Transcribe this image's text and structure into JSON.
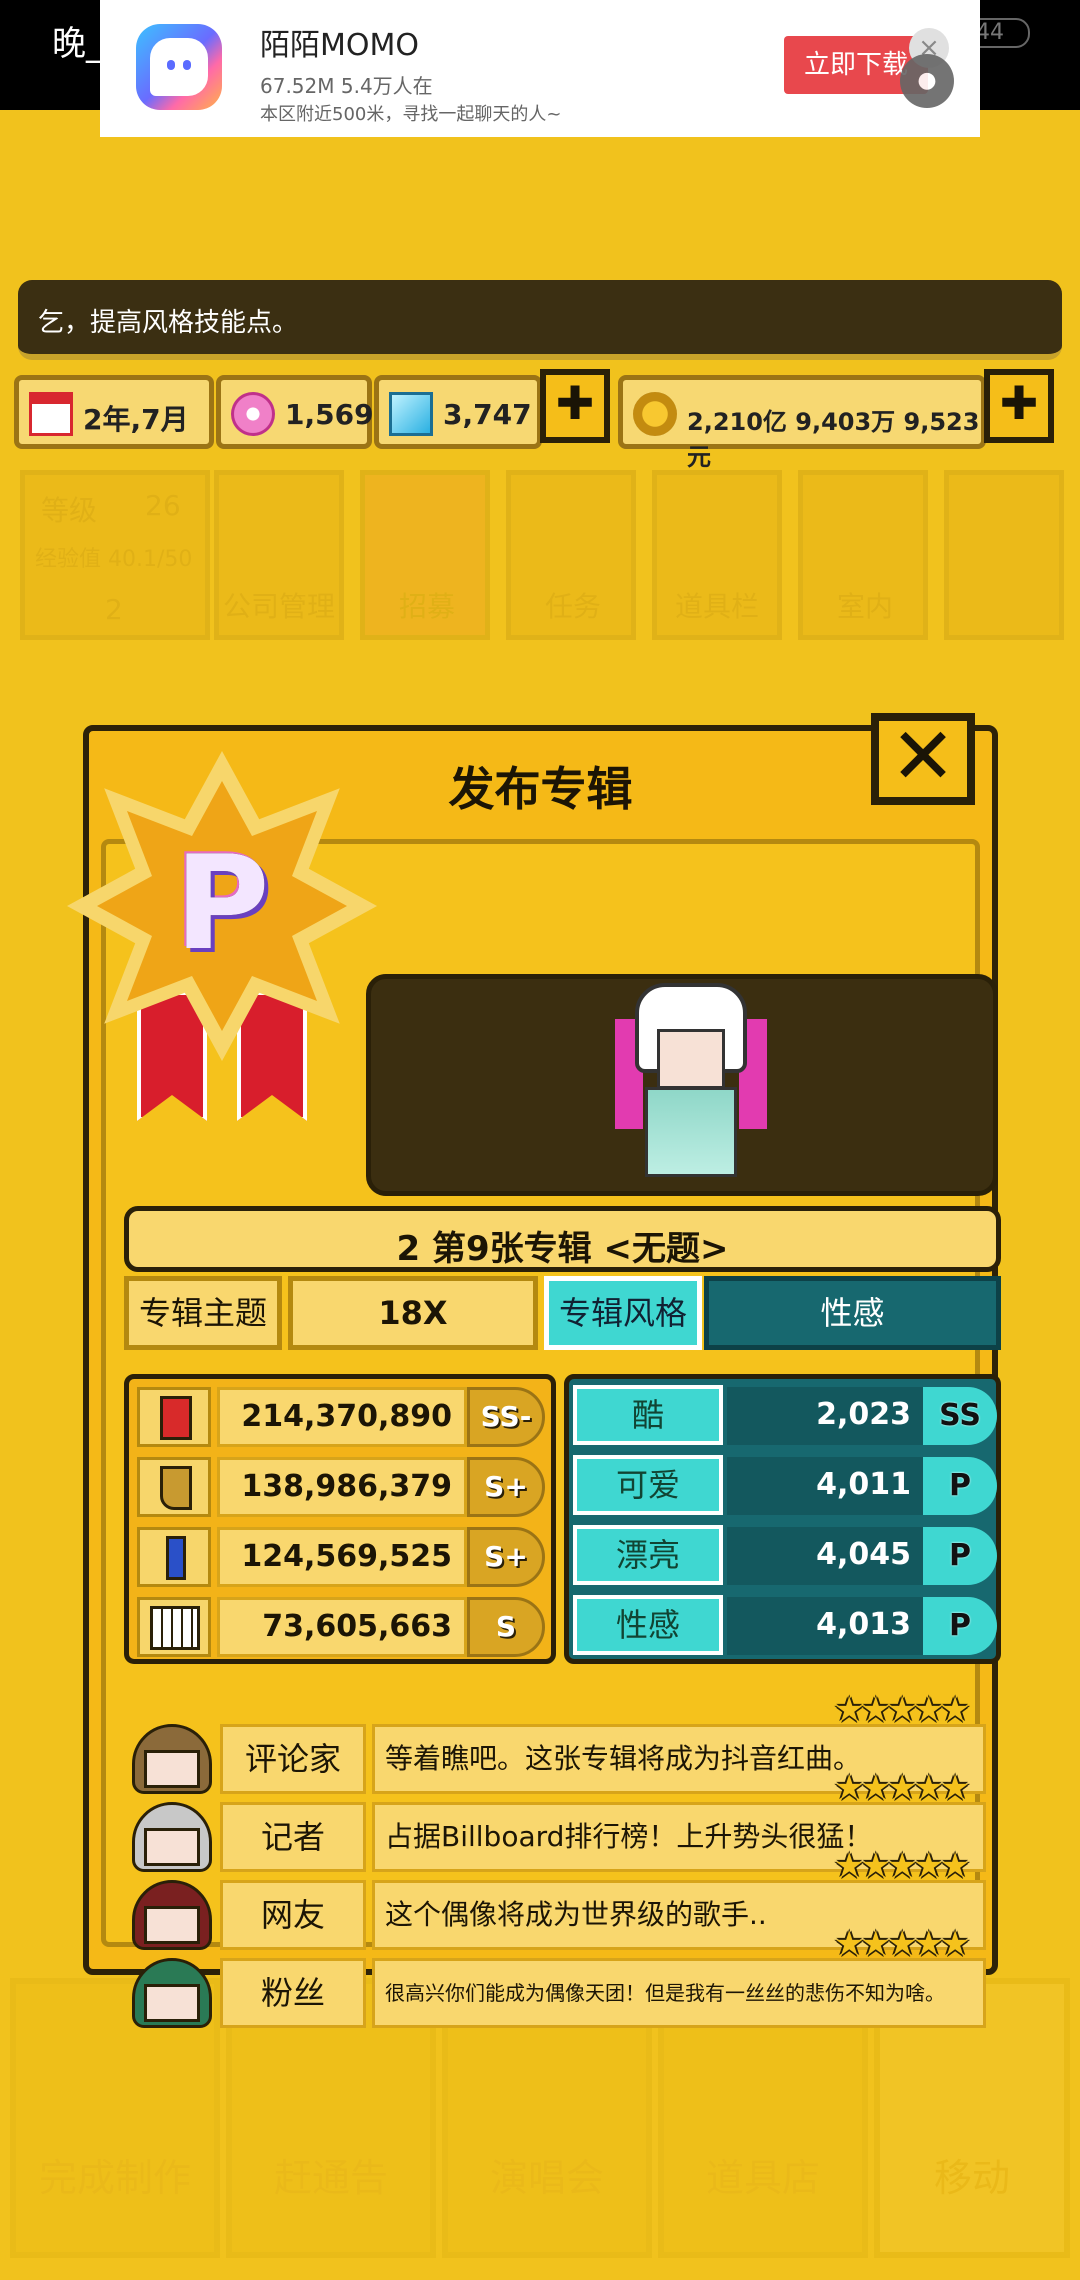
{
  "status": {
    "time": "晚_",
    "battery": "44"
  },
  "ad": {
    "title": "陌陌MOMO",
    "subtitle1": "67.52M 5.4万人在",
    "subtitle2": "本区附近500米，寻找一起聊天的人~",
    "cta": "立即下载",
    "close": "×"
  },
  "tip": "乞，提高风格技能点。",
  "resources": {
    "date": "2年,7月",
    "gems": "1,569",
    "diamonds": "3,747",
    "money": "2,210亿 9,403万 9,523元",
    "plus": "✚"
  },
  "background": {
    "level_label": "等级",
    "level": "26",
    "exp_label": "经验值 40.1/50",
    "level_num": "2",
    "tabs": [
      "公司管理",
      "招募",
      "任务",
      "道具栏",
      "室内"
    ],
    "bottom_nav": [
      "完成制作",
      "赶通告",
      "演唱会",
      "道具店",
      "移动"
    ]
  },
  "dialog": {
    "title": "发布专辑",
    "close": "✕",
    "medal_letter": "P",
    "album_title": "2 第9张专辑 <无题>",
    "theme_label": "专辑主题",
    "theme_value": "18X",
    "style_label": "专辑风格",
    "style_value": "性感",
    "stats_left": [
      {
        "icon": "mic-icon",
        "value": "214,370,890",
        "grade": "SS-"
      },
      {
        "icon": "boot-icon",
        "value": "138,986,379",
        "grade": "S+"
      },
      {
        "icon": "pen-icon",
        "value": "124,569,525",
        "grade": "S+"
      },
      {
        "icon": "piano-icon",
        "value": "73,605,663",
        "grade": "S"
      }
    ],
    "stats_right": [
      {
        "label": "酷",
        "value": "2,023",
        "grade": "SS"
      },
      {
        "label": "可爱",
        "value": "4,011",
        "grade": "P"
      },
      {
        "label": "漂亮",
        "value": "4,045",
        "grade": "P"
      },
      {
        "label": "性感",
        "value": "4,013",
        "grade": "P"
      }
    ],
    "reviews": [
      {
        "role": "评论家",
        "text": "等着瞧吧。这张专辑将成为抖音红曲。",
        "stars": 5,
        "hair": "#8b6a3a"
      },
      {
        "role": "记者",
        "text": "占据Billboard排行榜！上升势头很猛！",
        "stars": 5,
        "hair": "#c8c8c8"
      },
      {
        "role": "网友",
        "text": "这个偶像将成为世界级的歌手..",
        "stars": 5,
        "hair": "#7a2020"
      },
      {
        "role": "粉丝",
        "text": "很高兴你们能成为偶像天团！但是我有一丝丝的悲伤不知为啥。",
        "stars": 5,
        "hair": "#2a7a55"
      }
    ],
    "star_glyph": "★★★★★"
  }
}
